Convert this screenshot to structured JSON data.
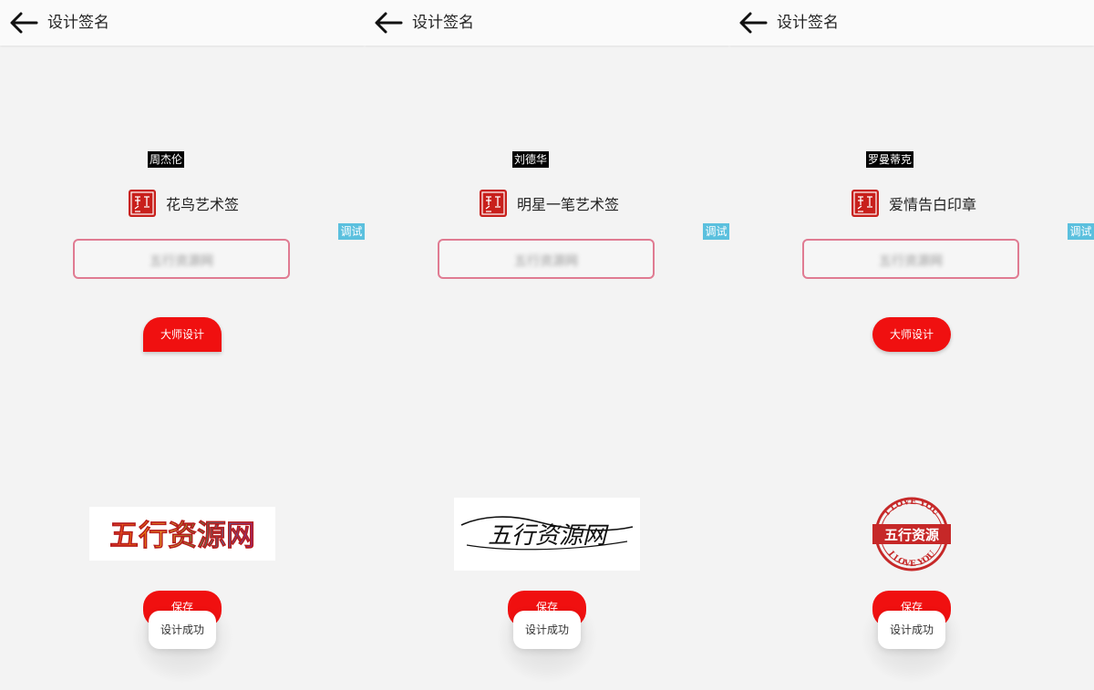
{
  "panels": [
    {
      "title": "设计签名",
      "name": "周杰伦",
      "style": "花鸟艺术签",
      "debug_label": "调试",
      "input_value": "五行资源网",
      "master_button": "大师设计",
      "save_button": "保存",
      "toast": "设计成功",
      "signature_text": "五行资源网"
    },
    {
      "title": "设计签名",
      "name": "刘德华",
      "style": "明星一笔艺术签",
      "debug_label": "调试",
      "input_value": "五行资源网",
      "save_button": "保存",
      "toast": "设计成功",
      "signature_text": "五行资源网"
    },
    {
      "title": "设计签名",
      "name": "罗曼蒂克",
      "style": "爱情告白印章",
      "debug_label": "调试",
      "input_value": "五行资源网",
      "master_button": "大师设计",
      "save_button": "保存",
      "toast": "设计成功",
      "stamp_top": "I LOVE YOU",
      "stamp_center": "五行资源",
      "stamp_bottom": "I LOVE YOU"
    }
  ],
  "icons": {
    "back": "arrow-left-icon",
    "style_seal": "seal-icon"
  },
  "colors": {
    "accent_red": "#f01010",
    "input_border": "#e07b92",
    "debug_badge": "#5bc0de"
  }
}
